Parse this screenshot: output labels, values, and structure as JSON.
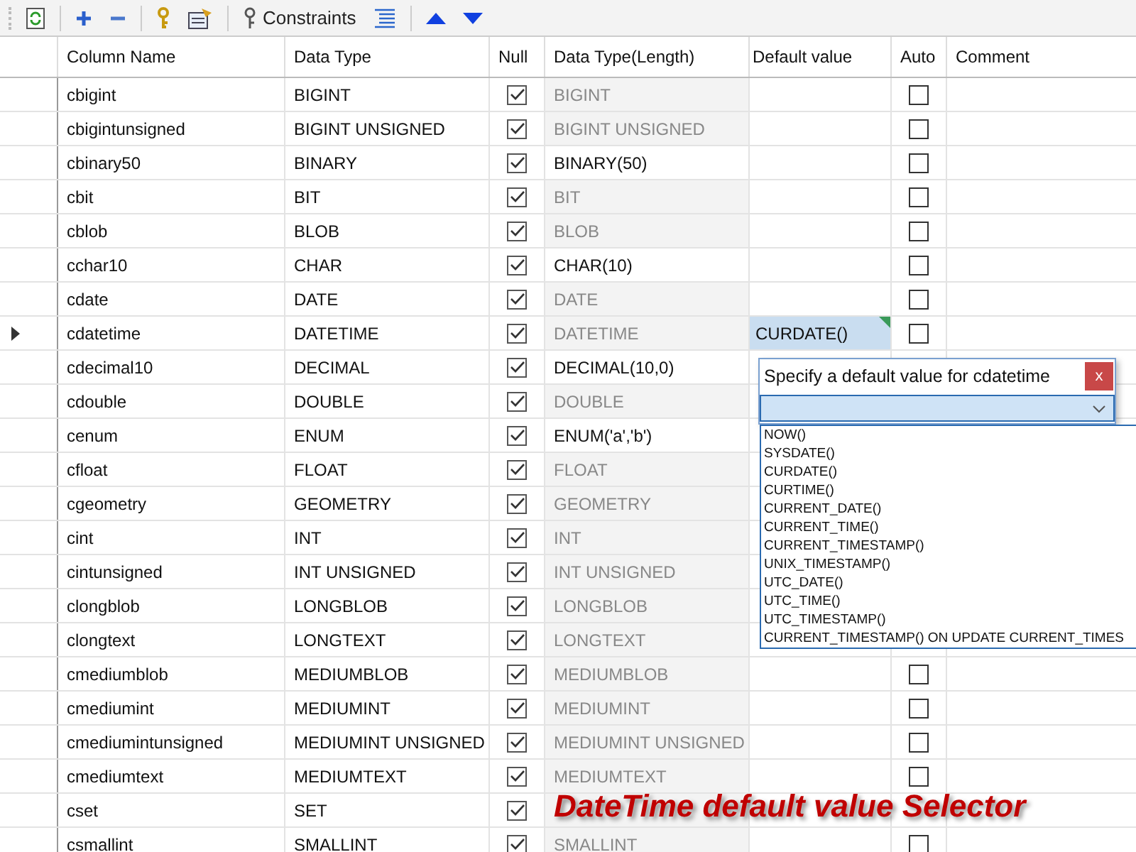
{
  "toolbar": {
    "constraints_label": "Constraints"
  },
  "table": {
    "columns": [
      "Column Name",
      "Data Type",
      "Null",
      "Data Type(Length)",
      "Default value",
      "Auto",
      "Comment"
    ],
    "rows": [
      {
        "name": "cbigint",
        "type": "BIGINT",
        "null": true,
        "length": "BIGINT",
        "length_editable": false,
        "auto": false,
        "selected": false
      },
      {
        "name": "cbigintunsigned",
        "type": "BIGINT UNSIGNED",
        "null": true,
        "length": "BIGINT UNSIGNED",
        "length_editable": false,
        "auto": false,
        "selected": false
      },
      {
        "name": "cbinary50",
        "type": "BINARY",
        "null": true,
        "length": "BINARY(50)",
        "length_editable": true,
        "auto": false,
        "selected": false
      },
      {
        "name": "cbit",
        "type": "BIT",
        "null": true,
        "length": "BIT",
        "length_editable": false,
        "auto": false,
        "selected": false
      },
      {
        "name": "cblob",
        "type": "BLOB",
        "null": true,
        "length": "BLOB",
        "length_editable": false,
        "auto": false,
        "selected": false
      },
      {
        "name": "cchar10",
        "type": "CHAR",
        "null": true,
        "length": "CHAR(10)",
        "length_editable": true,
        "auto": false,
        "selected": false
      },
      {
        "name": "cdate",
        "type": "DATE",
        "null": true,
        "length": "DATE",
        "length_editable": false,
        "auto": false,
        "selected": false
      },
      {
        "name": "cdatetime",
        "type": "DATETIME",
        "null": true,
        "length": "DATETIME",
        "length_editable": false,
        "default": "CURDATE()",
        "auto": false,
        "selected": true
      },
      {
        "name": "cdecimal10",
        "type": "DECIMAL",
        "null": true,
        "length": "DECIMAL(10,0)",
        "length_editable": true,
        "selected": false
      },
      {
        "name": "cdouble",
        "type": "DOUBLE",
        "null": true,
        "length": "DOUBLE",
        "length_editable": false,
        "selected": false
      },
      {
        "name": "cenum",
        "type": "ENUM",
        "null": true,
        "length": "ENUM('a','b')",
        "length_editable": true,
        "selected": false
      },
      {
        "name": "cfloat",
        "type": "FLOAT",
        "null": true,
        "length": "FLOAT",
        "length_editable": false,
        "selected": false
      },
      {
        "name": "cgeometry",
        "type": "GEOMETRY",
        "null": true,
        "length": "GEOMETRY",
        "length_editable": false,
        "selected": false
      },
      {
        "name": "cint",
        "type": "INT",
        "null": true,
        "length": "INT",
        "length_editable": false,
        "selected": false
      },
      {
        "name": "cintunsigned",
        "type": "INT UNSIGNED",
        "null": true,
        "length": "INT UNSIGNED",
        "length_editable": false,
        "selected": false
      },
      {
        "name": "clongblob",
        "type": "LONGBLOB",
        "null": true,
        "length": "LONGBLOB",
        "length_editable": false,
        "selected": false
      },
      {
        "name": "clongtext",
        "type": "LONGTEXT",
        "null": true,
        "length": "LONGTEXT",
        "length_editable": false,
        "selected": false
      },
      {
        "name": "cmediumblob",
        "type": "MEDIUMBLOB",
        "null": true,
        "length": "MEDIUMBLOB",
        "length_editable": false,
        "auto": false,
        "selected": false
      },
      {
        "name": "cmediumint",
        "type": "MEDIUMINT",
        "null": true,
        "length": "MEDIUMINT",
        "length_editable": false,
        "auto": false,
        "selected": false
      },
      {
        "name": "cmediumintunsigned",
        "type": "MEDIUMINT UNSIGNED",
        "null": true,
        "length": "MEDIUMINT UNSIGNED",
        "length_editable": false,
        "auto": false,
        "selected": false
      },
      {
        "name": "cmediumtext",
        "type": "MEDIUMTEXT",
        "null": true,
        "length": "MEDIUMTEXT",
        "length_editable": false,
        "auto": false,
        "selected": false
      },
      {
        "name": "cset",
        "type": "SET",
        "null": true,
        "length_editable": false,
        "selected": false
      },
      {
        "name": "csmallint",
        "type": "SMALLINT",
        "null": true,
        "length": "SMALLINT",
        "length_editable": false,
        "auto": false,
        "selected": false
      }
    ]
  },
  "popup": {
    "title": "Specify a default value for cdatetime",
    "close": "x",
    "options": [
      "NOW()",
      "SYSDATE()",
      "CURDATE()",
      "CURTIME()",
      "CURRENT_DATE()",
      "CURRENT_TIME()",
      "CURRENT_TIMESTAMP()",
      "UNIX_TIMESTAMP()",
      "UTC_DATE()",
      "UTC_TIME()",
      "UTC_TIMESTAMP()",
      "CURRENT_TIMESTAMP() ON UPDATE CURRENT_TIMES"
    ]
  },
  "caption": "DateTime default value Selector"
}
